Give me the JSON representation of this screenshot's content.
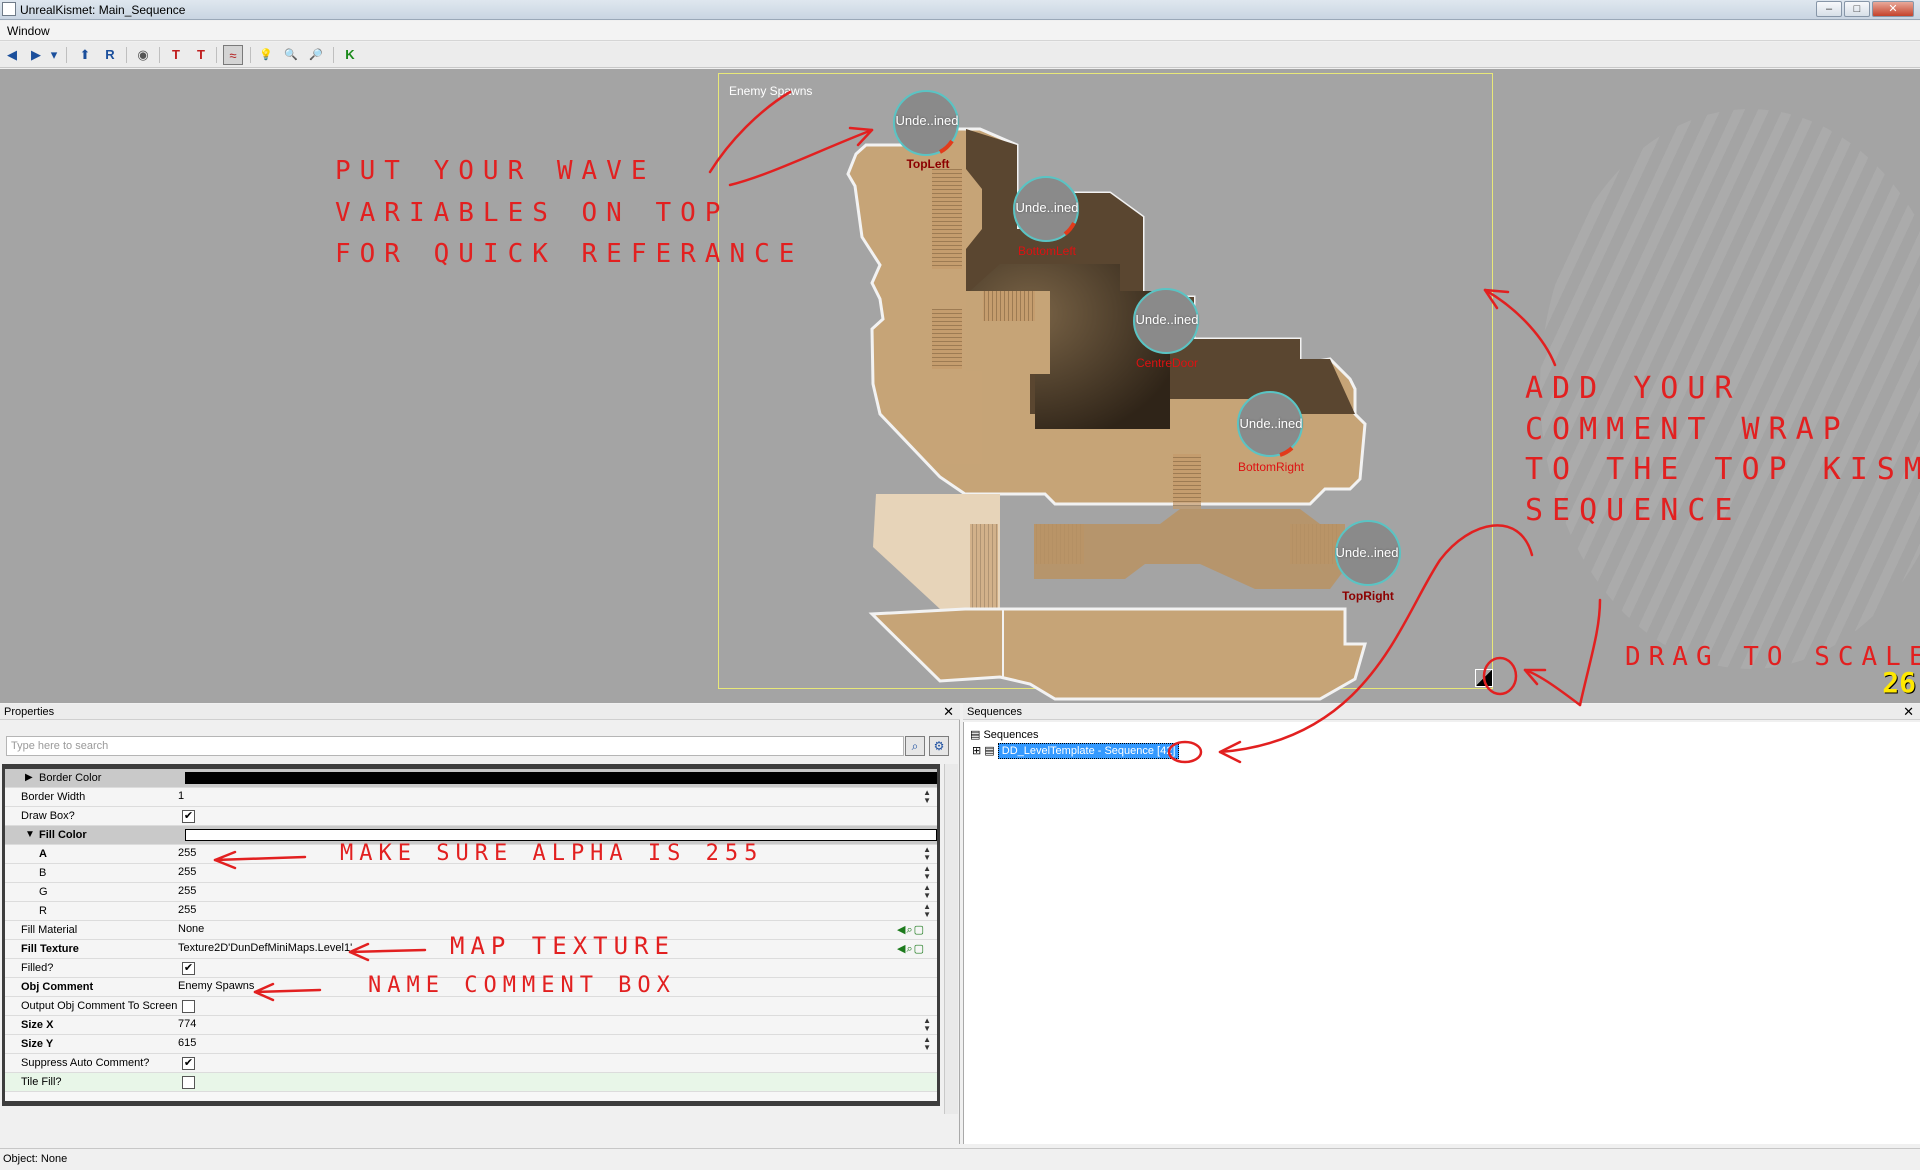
{
  "window": {
    "title": "UnrealKismet: Main_Sequence",
    "controls": {
      "minimize": "–",
      "maximize": "□",
      "close": "✕"
    }
  },
  "menu": {
    "items": [
      "Window"
    ]
  },
  "toolbar": {
    "buttons": [
      {
        "icon": "back-arrow-icon",
        "glyph": "◀"
      },
      {
        "icon": "forward-arrow-icon",
        "glyph": "▶"
      },
      {
        "icon": "history-dropdown-icon",
        "glyph": "▾"
      },
      {
        "icon": "parent-sequence-icon",
        "glyph": "⬆"
      },
      {
        "icon": "rename-sequence-icon",
        "glyph": "R"
      },
      {
        "icon": "view-icon",
        "glyph": "◉"
      },
      {
        "icon": "search-type-icon",
        "glyph": "T"
      },
      {
        "icon": "search-text-icon",
        "glyph": "T"
      },
      {
        "icon": "curve-editor-icon",
        "glyph": "≈"
      },
      {
        "icon": "bulb-icon",
        "glyph": "💡"
      },
      {
        "icon": "zoom-icon",
        "glyph": "🔍"
      },
      {
        "icon": "find-icon",
        "glyph": "🔎"
      },
      {
        "icon": "kismet-icon",
        "glyph": "K"
      }
    ]
  },
  "canvas": {
    "comment_title": "Enemy Spawns",
    "fps": "26",
    "variables": [
      {
        "value": "Unde..ined",
        "name": "TopLeft",
        "style": "dark"
      },
      {
        "value": "Unde..ined",
        "name": "BottomLeft",
        "style": "red"
      },
      {
        "value": "Unde..ined",
        "name": "CentreDoor",
        "style": "red"
      },
      {
        "value": "Unde..ined",
        "name": "BottomRight",
        "style": "red"
      },
      {
        "value": "Unde..ined",
        "name": "TopRight",
        "style": "dark"
      }
    ],
    "notes": {
      "wave": "PUT YOUR WAVE\nVARIABLES ON TOP\nFOR QUICK REFERANCE",
      "comment": "ADD YOUR\nCOMMENT WRAP\nTO THE TOP KISMET\nSEQUENCE",
      "drag": "DRAG TO SCALE",
      "alpha": "MAKE SURE ALPHA IS 255",
      "texture": "MAP TEXTURE",
      "name": "NAME COMMENT BOX"
    }
  },
  "properties": {
    "title": "Properties",
    "close": "✕",
    "search_placeholder": "Type here to search",
    "rows": [
      {
        "name": "Border Color",
        "kind": "color",
        "color": "#000000"
      },
      {
        "name": "Border Width",
        "value": "1"
      },
      {
        "name": "Draw Box?",
        "kind": "check",
        "checked": true
      },
      {
        "name": "Fill Color",
        "kind": "color",
        "color": "#ffffff"
      },
      {
        "name": "A",
        "value": "255"
      },
      {
        "name": "B",
        "value": "255"
      },
      {
        "name": "G",
        "value": "255"
      },
      {
        "name": "R",
        "value": "255"
      },
      {
        "name": "Fill Material",
        "value": "None"
      },
      {
        "name": "Fill Texture",
        "value": "Texture2D'DunDefMiniMaps.Level1'"
      },
      {
        "name": "Filled?",
        "kind": "check",
        "checked": true
      },
      {
        "name": "Obj Comment",
        "value": "Enemy Spawns"
      },
      {
        "name": "Output Obj Comment To Screen",
        "kind": "check",
        "checked": false
      },
      {
        "name": "Size X",
        "value": "774"
      },
      {
        "name": "Size Y",
        "value": "615"
      },
      {
        "name": "Suppress Auto Comment?",
        "kind": "check",
        "checked": true
      },
      {
        "name": "Tile Fill?",
        "kind": "check",
        "checked": false
      }
    ]
  },
  "sequences": {
    "title": "Sequences",
    "close": "✕",
    "root": "Sequences",
    "child": "DD_LevelTemplate - Sequence [42]"
  },
  "status": {
    "text": "Object: None"
  },
  "colors": {
    "canvas_bg": "#a4a4a4",
    "annotation": "#e22020",
    "map_light": "#c6a477",
    "map_dark": "#5a4630",
    "selection": "#3399ff"
  }
}
